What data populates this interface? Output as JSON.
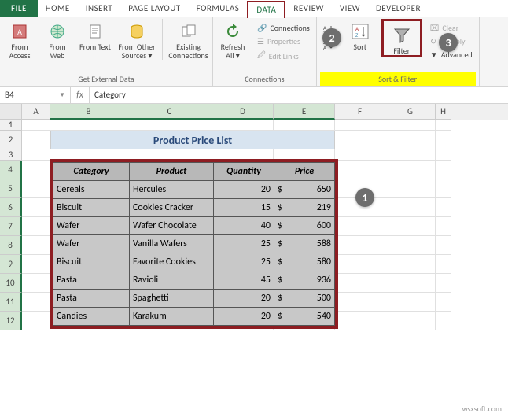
{
  "ribbon_tabs": {
    "file": "FILE",
    "home": "HOME",
    "insert": "INSERT",
    "page_layout": "PAGE LAYOUT",
    "formulas": "FORMULAS",
    "data": "DATA",
    "review": "REVIEW",
    "view": "VIEW",
    "developer": "DEVELOPER"
  },
  "groups": {
    "ext_data": {
      "label": "Get External Data",
      "from_access": "From Access",
      "from_web": "From Web",
      "from_text": "From Text",
      "from_other": "From Other Sources ▾",
      "existing": "Existing Connections"
    },
    "connections": {
      "label": "Connections",
      "refresh": "Refresh All ▾",
      "connections": "Connections",
      "properties": "Properties",
      "edit_links": "Edit Links"
    },
    "sort_filter": {
      "label": "Sort & Filter",
      "sort": "Sort",
      "filter": "Filter",
      "clear": "Clear",
      "reapply": "Reapply",
      "advanced": "Advanced"
    }
  },
  "name_box": "B4",
  "formula_value": "Category",
  "columns": [
    "A",
    "B",
    "C",
    "D",
    "E",
    "F",
    "G",
    "H"
  ],
  "title": "Product Price List",
  "table": {
    "headers": [
      "Category",
      "Product",
      "Quantity",
      "Price"
    ],
    "rows": [
      {
        "category": "Cereals",
        "product": "Hercules",
        "qty": "20",
        "cur": "$",
        "price": "650"
      },
      {
        "category": "Biscuit",
        "product": "Cookies Cracker",
        "qty": "15",
        "cur": "$",
        "price": "219"
      },
      {
        "category": "Wafer",
        "product": "Wafer Chocolate",
        "qty": "40",
        "cur": "$",
        "price": "600"
      },
      {
        "category": "Wafer",
        "product": "Vanilla Wafers",
        "qty": "25",
        "cur": "$",
        "price": "588"
      },
      {
        "category": "Biscuit",
        "product": "Favorite Cookies",
        "qty": "25",
        "cur": "$",
        "price": "580"
      },
      {
        "category": "Pasta",
        "product": "Ravioli",
        "qty": "45",
        "cur": "$",
        "price": "936"
      },
      {
        "category": "Pasta",
        "product": "Spaghetti",
        "qty": "20",
        "cur": "$",
        "price": "500"
      },
      {
        "category": "Candies",
        "product": "Karakum",
        "qty": "20",
        "cur": "$",
        "price": "540"
      }
    ]
  },
  "callouts": {
    "c1": "1",
    "c2": "2",
    "c3": "3"
  },
  "watermark": "wsxsoft.com"
}
